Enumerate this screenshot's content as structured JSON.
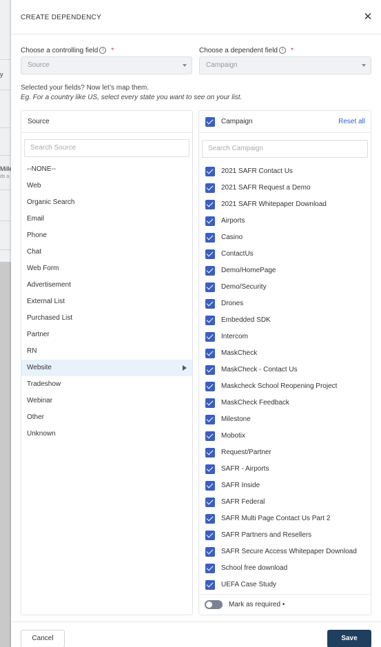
{
  "background": {
    "frag1": "y",
    "frag2": "Mille",
    "frag3": "ds a"
  },
  "modal": {
    "title": "CREATE DEPENDENCY",
    "close_icon": "close-icon"
  },
  "controlling": {
    "label": "Choose a controlling field",
    "info_glyph": "i",
    "required_mark": "*",
    "value": "Source"
  },
  "dependent": {
    "label": "Choose a dependent field",
    "info_glyph": "i",
    "required_mark": "*",
    "value": "Campaign"
  },
  "hint": {
    "line1": "Selected your fields? Now let’s map them.",
    "line2": "Eg. For a country like US, select every state you want to see on your list."
  },
  "source_panel": {
    "header": "Source",
    "search_placeholder": "Search Source",
    "selected": "Website",
    "items": [
      "--NONE--",
      "Web",
      "Organic Search",
      "Email",
      "Phone",
      "Chat",
      "Web Form",
      "Advertisement",
      "External List",
      "Purchased List",
      "Partner",
      "RN",
      "Website",
      "Tradeshow",
      "Webinar",
      "Other",
      "Unknown"
    ]
  },
  "campaign_panel": {
    "header": "Campaign",
    "header_checked": true,
    "reset_label": "Reset all",
    "search_placeholder": "Search Campaign",
    "items": [
      "2021 SAFR Contact Us",
      "2021 SAFR Request a Demo",
      "2021 SAFR Whitepaper Download",
      "Airports",
      "Casino",
      "ContactUs",
      "Demo/HomePage",
      "Demo/Security",
      "Drones",
      "Embedded SDK",
      "Intercom",
      "MaskCheck",
      "MaskCheck - Contact Us",
      "Maskcheck School Reopening Project",
      "MaskCheck Feedback",
      "Milestone",
      "Mobotix",
      "Request/Partner",
      "SAFR - Airports",
      "SAFR Inside",
      "SAFR Federal",
      "SAFR Multi Page Contact Us Part 2",
      "SAFR Partners and Resellers",
      "SAFR Secure Access Whitepaper Download",
      "School free download",
      "UEFA Case Study"
    ],
    "all_checked": true,
    "mark_required_label": "Mark as required",
    "mark_required_on": false,
    "mark_required_suffix": "•"
  },
  "footer": {
    "cancel_label": "Cancel",
    "save_label": "Save"
  },
  "colors": {
    "accent_blue": "#3b5fc0",
    "link_blue": "#2d63c8",
    "save_button": "#1f3f5e",
    "selected_row": "#e9f2fb",
    "required_red": "#e0243a"
  }
}
